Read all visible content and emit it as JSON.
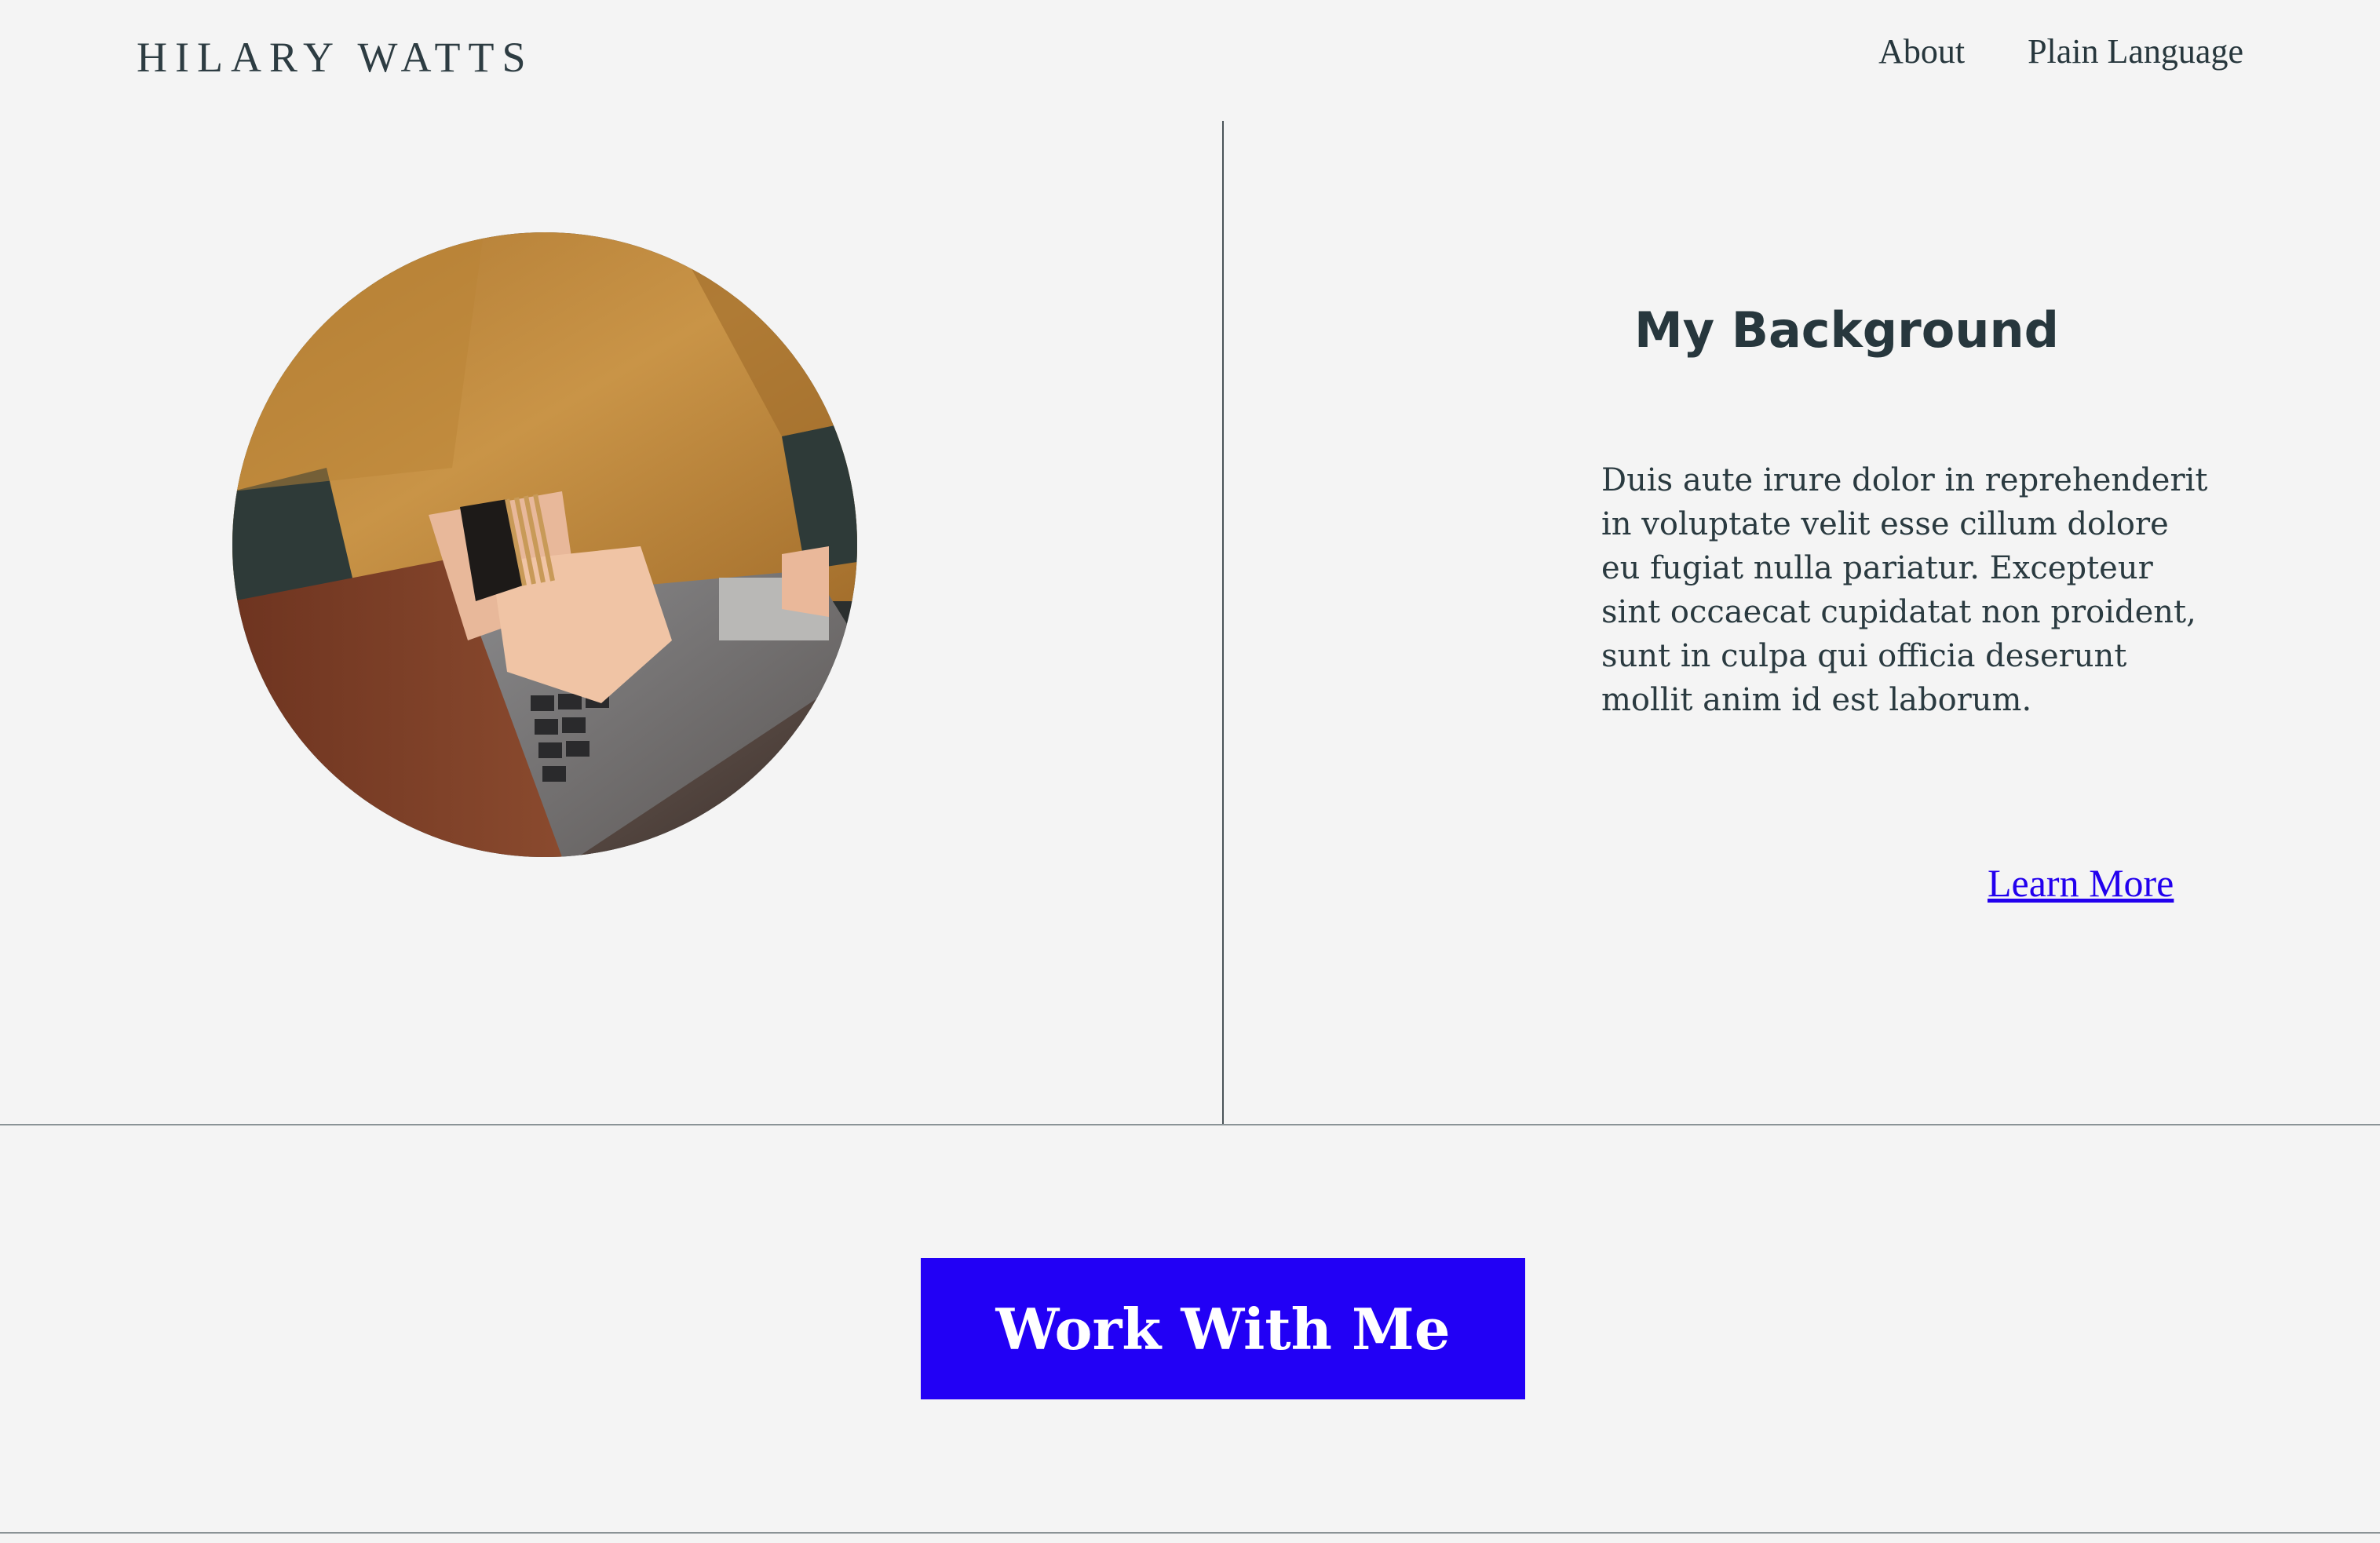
{
  "header": {
    "logo": "HILARY WATTS",
    "nav": [
      {
        "label": "About"
      },
      {
        "label": "Plain Language"
      }
    ]
  },
  "background_section": {
    "photo_icon": "woman-typing-on-laptop-photo",
    "title": "My Background",
    "body": "Duis aute irure dolor in reprehenderit in voluptate velit esse cillum dolore eu fugiat nulla pariatur. Excepteur sint occaecat cupidatat non proident, sunt in culpa qui officia deserunt mollit anim id est laborum.",
    "link_label": "Learn More"
  },
  "cta": {
    "label": "Work With Me"
  },
  "colors": {
    "background": "#f4f4f4",
    "text": "#27373d",
    "accent": "#2200f5",
    "link": "#2200ee"
  }
}
